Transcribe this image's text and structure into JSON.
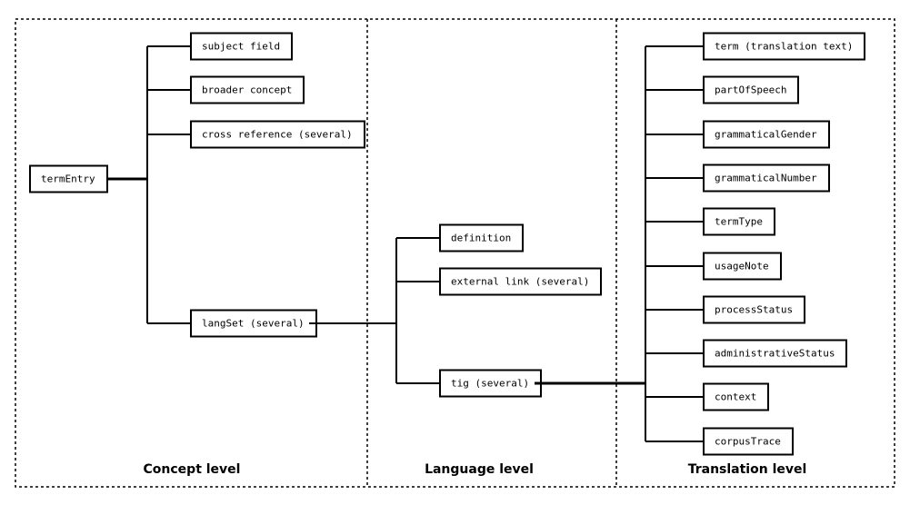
{
  "levels": [
    {
      "id": "concept",
      "label": "Concept level"
    },
    {
      "id": "language",
      "label": "Language level"
    },
    {
      "id": "translation",
      "label": "Translation level"
    }
  ],
  "root": {
    "label": "termEntry"
  },
  "concept_children": [
    "subject field",
    "broader concept",
    "cross reference (several)",
    "langSet (several)"
  ],
  "language_children": [
    "definition",
    "external link (several)",
    "tig (several)"
  ],
  "translation_children": [
    "term (translation text)",
    "partOfSpeech",
    "grammaticalGender",
    "grammaticalNumber",
    "termType",
    "usageNote",
    "processStatus",
    "administrativeStatus",
    "context",
    "corpusTrace"
  ]
}
